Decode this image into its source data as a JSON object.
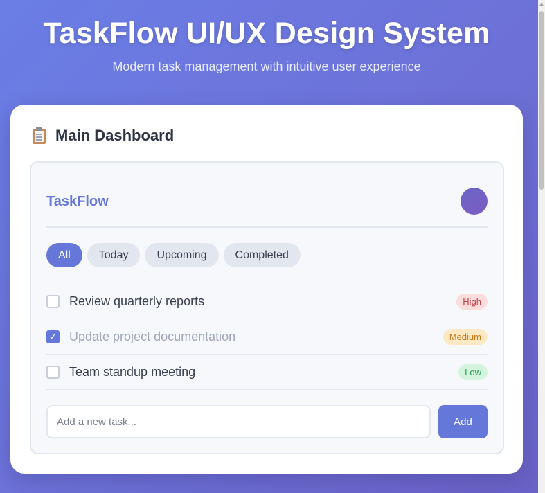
{
  "hero": {
    "title": "TaskFlow UI/UX Design System",
    "subtitle": "Modern task management with intuitive user experience"
  },
  "card": {
    "icon": "clipboard-icon",
    "title": "Main Dashboard"
  },
  "app": {
    "brand": "TaskFlow",
    "filters": [
      "All",
      "Today",
      "Upcoming",
      "Completed"
    ],
    "active_filter": "All",
    "tasks": [
      {
        "text": "Review quarterly reports",
        "done": false,
        "priority": "High"
      },
      {
        "text": "Update project documentation",
        "done": true,
        "priority": "Medium"
      },
      {
        "text": "Team standup meeting",
        "done": false,
        "priority": "Low"
      }
    ],
    "new_task_placeholder": "Add a new task...",
    "add_label": "Add",
    "check_glyph": "✓"
  },
  "colors": {
    "accent": "#6577d9",
    "high": "#c0424c",
    "medium": "#c97a19",
    "low": "#2d9b57"
  }
}
